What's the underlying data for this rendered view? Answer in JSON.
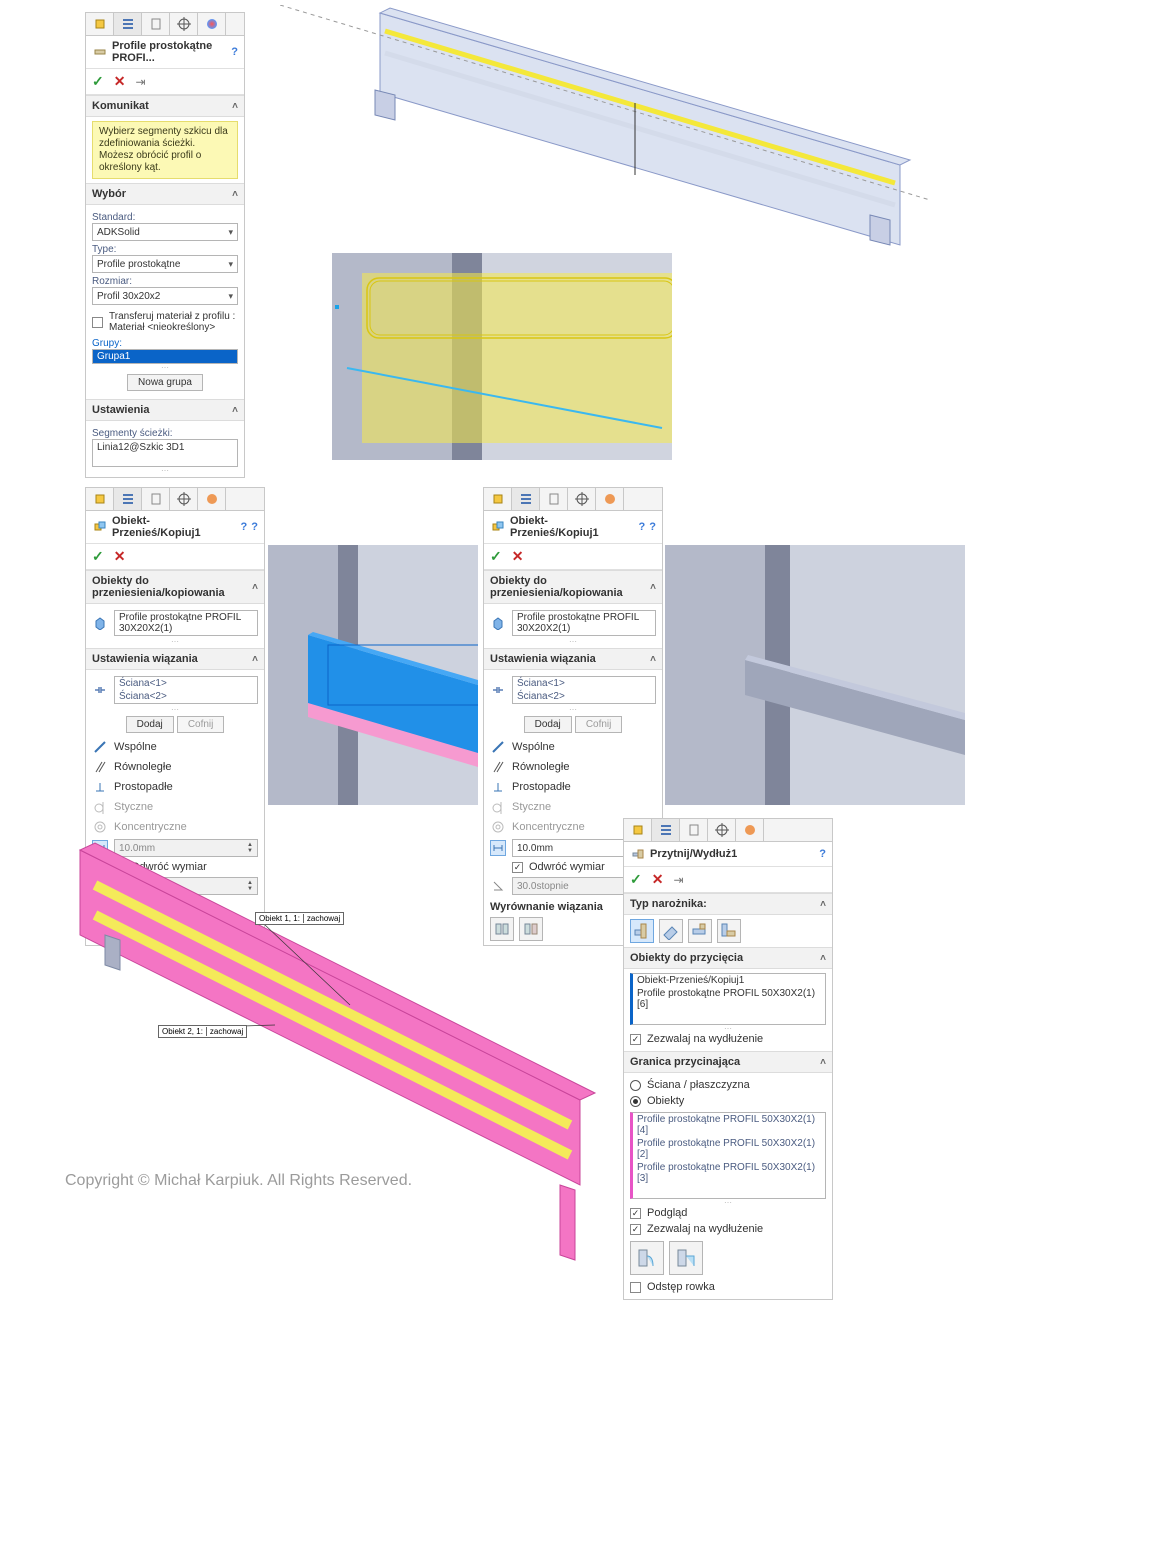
{
  "copyright_text": "Copyright © Michał Karpiuk. All Rights Reserved.",
  "panel_profile": {
    "title": "Profile prostokątne PROFI...",
    "section_msg_label": "Komunikat",
    "msg": "Wybierz segmenty szkicu dla zdefiniowania ścieżki. Możesz obrócić profil o określony kąt.",
    "section_sel_label": "Wybór",
    "std_label": "Standard:",
    "std_value": "ADKSolid",
    "type_label": "Type:",
    "type_value": "Profile prostokątne",
    "size_label": "Rozmiar:",
    "size_value": "Profil 30x20x2",
    "transfer_label": "Transferuj materiał z profilu :\nMateriał <nieokreślony>",
    "groups_label": "Grupy:",
    "group_item": "Grupa1",
    "new_group_btn": "Nowa grupa",
    "section_set_label": "Ustawienia",
    "segments_label": "Segmenty ścieżki:",
    "segments_value": "Linia12@Szkic 3D1"
  },
  "panel_move": {
    "title": "Obiekt-Przenieś/Kopiuj1",
    "bodies_hdr": "Obiekty do przeniesienia/kopiowania",
    "body_item": "Profile prostokątne PROFIL 30X20X2(1)",
    "mate_hdr": "Ustawienia wiązania",
    "mate1": "Ściana<1>",
    "mate2": "Ściana<2>",
    "add_btn": "Dodaj",
    "undo_btn": "Cofnij",
    "coincident": "Wspólne",
    "parallel": "Równoległe",
    "perpendicular": "Prostopadłe",
    "tangent": "Styczne",
    "concentric": "Koncentryczne",
    "distance_value": "10.0mm",
    "flip_label": "Odwróć wymiar",
    "angle_value": "30.0stopnie",
    "align_label": "Wyrównanie wiązania"
  },
  "panel_move2": {
    "flip_checked": true
  },
  "panel_trim": {
    "title": "Przytnij/Wydłuż1",
    "corner_hdr": "Typ narożnika:",
    "bodies_hdr": "Obiekty do przycięcia",
    "body1": "Obiekt-Przenieś/Kopiuj1",
    "body2": "Profile prostokątne PROFIL 50X30X2(1)[6]",
    "allow_extend": "Zezwalaj na wydłużenie",
    "boundary_hdr": "Granica przycinająca",
    "opt_face": "Ściana / płaszczyzna",
    "opt_bodies": "Obiekty",
    "bnd1": "Profile prostokątne PROFIL 50X30X2(1)[4]",
    "bnd2": "Profile prostokątne PROFIL 50X30X2(1)[2]",
    "bnd3": "Profile prostokątne PROFIL 50X30X2(1)[3]",
    "preview": "Podgląd",
    "allow_extend2": "Zezwalaj na wydłużenie",
    "gap": "Odstęp rowka"
  },
  "captions": {
    "c1a": "Obiekt  1,  1:",
    "c1b": "zachowaj",
    "c2a": "Obiekt  2,  1:",
    "c2b": "zachowaj"
  }
}
